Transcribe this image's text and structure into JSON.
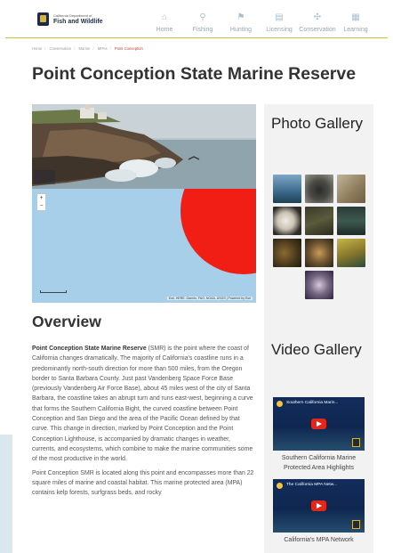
{
  "header": {
    "logo": {
      "line1": "California Department of",
      "line2": "Fish and Wildlife"
    },
    "nav": [
      {
        "label": "Home",
        "icon": "home-icon",
        "glyph": "⌂"
      },
      {
        "label": "Fishing",
        "icon": "fish-icon",
        "glyph": "⚲"
      },
      {
        "label": "Hunting",
        "icon": "hunting-icon",
        "glyph": "⚑"
      },
      {
        "label": "Licensing",
        "icon": "license-icon",
        "glyph": "▤"
      },
      {
        "label": "Conservation",
        "icon": "conservation-icon",
        "glyph": "✣"
      },
      {
        "label": "Learning",
        "icon": "learning-icon",
        "glyph": "▦"
      }
    ]
  },
  "breadcrumb": [
    "Home",
    "Conservation",
    "Marine",
    "MPAs",
    "Point Conception"
  ],
  "page_title": "Point Conception State Marine Reserve",
  "map": {
    "zoom_in": "+",
    "zoom_out": "−",
    "attribution": "Esri, HERE, Garmin, FAO, NOAA, USGS | Powered by Esri"
  },
  "sidebar": {
    "photo_heading": "Photo Gallery",
    "video_heading": "Video Gallery",
    "videos": [
      {
        "thumb_title": "Southern California Marin...",
        "caption": "Southern California Marine Protected Area Highlights"
      },
      {
        "thumb_title": "The California MPA Netw...",
        "caption": "California's MPA Network"
      }
    ]
  },
  "overview": {
    "heading": "Overview",
    "p1_bold": "Point Conception State Marine Reserve",
    "p1_rest": " (SMR) is the point where the coast of California changes dramatically. The majority of California's coastline runs in a predominantly north-south direction for more than 500 miles, from the Oregon border to Santa Barbara County. Just past Vandenberg Space Force Base (previously Vandenberg Air Force Base), about 45 miles west of the city of Santa Barbara, the coastline takes an abrupt turn and runs east-west, beginning a curve that forms the Southern California Bight, the curved coastline between Point Conception and San Diego and the area of the Pacific Ocean defined by that curve. This change in direction, marked by Point Conception and the Point Conception Lighthouse, is accompanied by dramatic changes in weather, currents, and ecosystems, which combine to make the marine communities some of the most productive in the world.",
    "p2": "Point Conception SMR is located along this point and encompasses more than 22 square miles of marine and coastal habitat. This marine protected area (MPA) contains kelp forests, surfgrass beds, and rocky"
  },
  "colors": {
    "accent_rule": "#c9c23a",
    "map_water": "#a7cfe9",
    "map_area": "#f01e14",
    "sidebar_bg": "#f2f2f2"
  }
}
